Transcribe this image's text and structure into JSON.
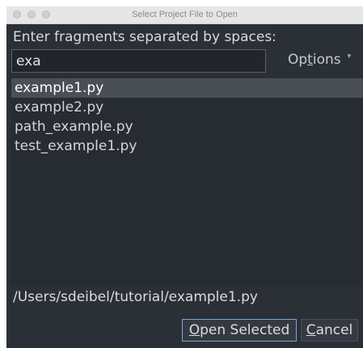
{
  "window": {
    "title": "Select Project File to Open"
  },
  "prompt": "Enter fragments separated by spaces:",
  "search": {
    "value": "exa"
  },
  "options": {
    "mnemonic_pre": "Op",
    "mnemonic": "t",
    "mnemonic_post": "ions",
    "caret": "▾"
  },
  "files": [
    {
      "name": "example1.py",
      "selected": true
    },
    {
      "name": "example2.py",
      "selected": false
    },
    {
      "name": "path_example.py",
      "selected": false
    },
    {
      "name": "test_example1.py",
      "selected": false
    }
  ],
  "selected_path": "/Users/sdeibel/tutorial/example1.py",
  "buttons": {
    "open_mnemonic": "O",
    "open_rest": "pen Selected",
    "cancel_mnemonic": "C",
    "cancel_rest": "ancel"
  },
  "colors": {
    "dialog_bg": "#2b3036",
    "selection_bg": "#4a4f56",
    "focus_ring": "#7ea6d8"
  }
}
